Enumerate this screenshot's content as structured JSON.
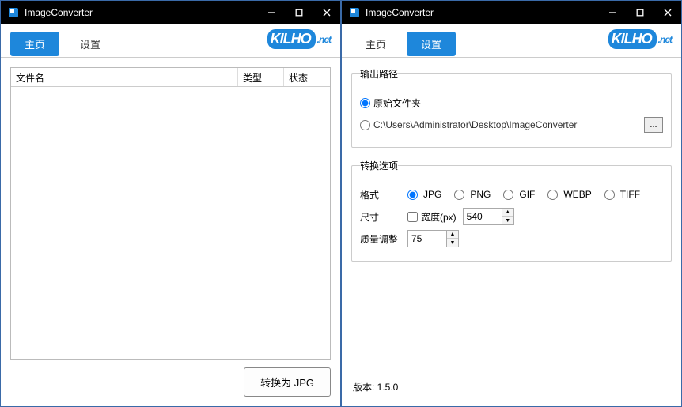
{
  "app_title": "ImageConverter",
  "tabs": {
    "home": "主页",
    "settings": "设置"
  },
  "brand": {
    "main": "KILHO",
    "tail": ".net"
  },
  "left": {
    "columns": {
      "name": "文件名",
      "type": "类型",
      "status": "状态"
    },
    "convert_button": "转换为 JPG"
  },
  "right": {
    "output_path": {
      "title": "输出路径",
      "opt_original": "原始文件夹",
      "opt_custom_path": "C:\\Users\\Administrator\\Desktop\\ImageConverter",
      "browse_label": "..."
    },
    "convert_opts": {
      "title": "转换选项",
      "format_label": "格式",
      "formats": {
        "jpg": "JPG",
        "png": "PNG",
        "gif": "GIF",
        "webp": "WEBP",
        "tiff": "TIFF"
      },
      "size_label": "尺寸",
      "width_label": "宽度(px)",
      "width_value": "540",
      "quality_label": "质量调整",
      "quality_value": "75"
    },
    "version_label": "版本: 1.5.0"
  }
}
